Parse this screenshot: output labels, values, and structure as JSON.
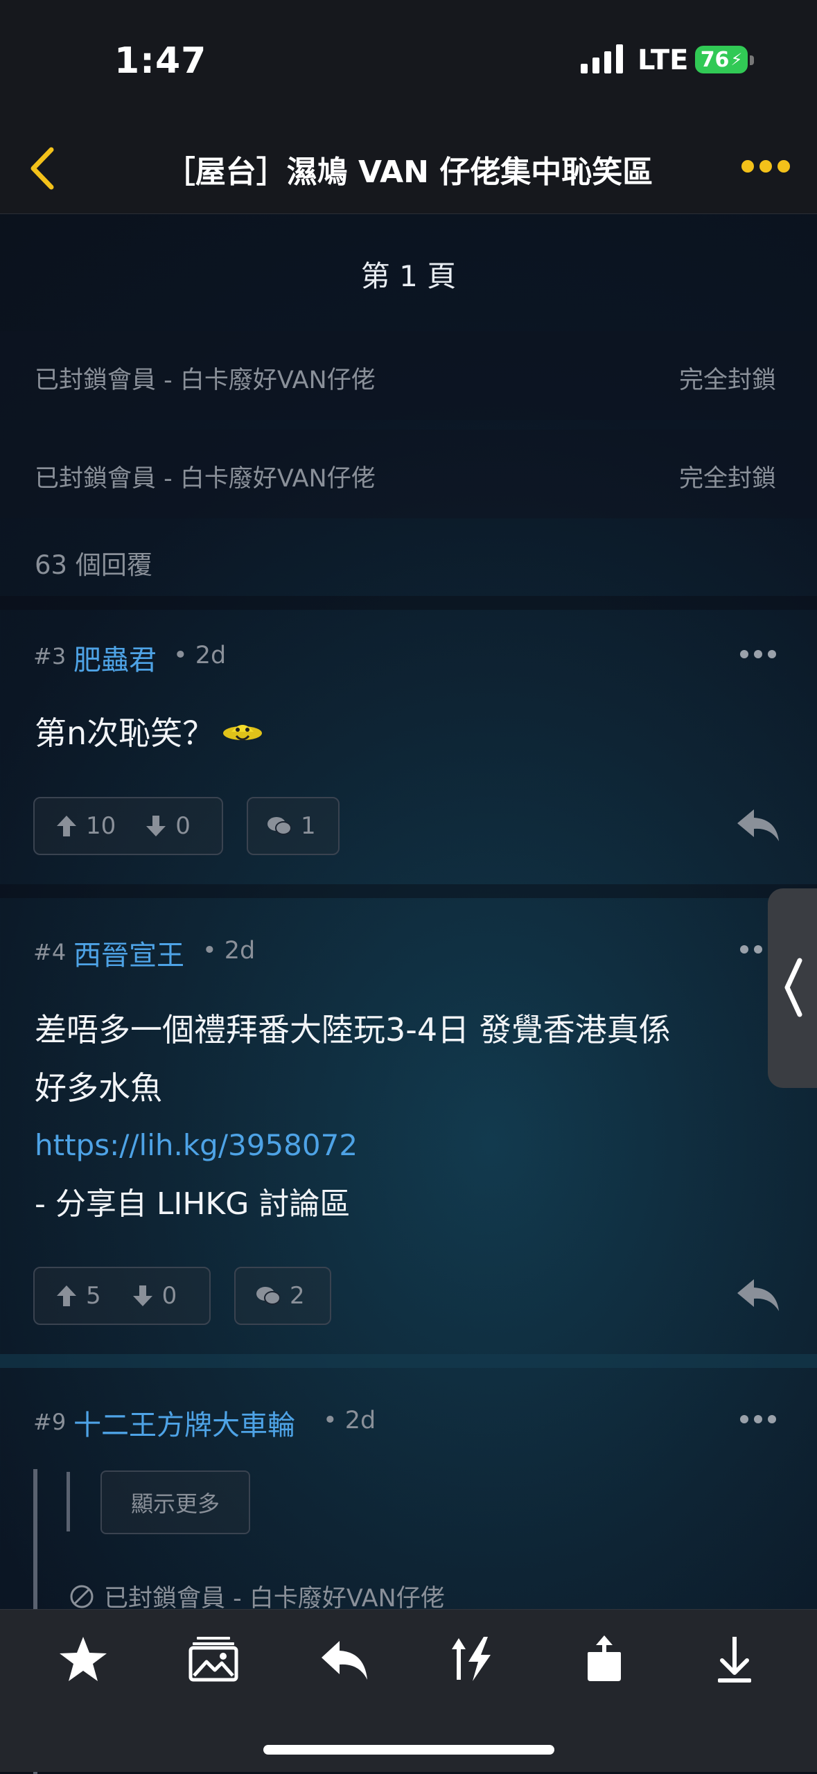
{
  "status_bar": {
    "time": "1:47",
    "network": "LTE",
    "battery": "76"
  },
  "nav": {
    "title": "［屋台］濕鳩 VAN 仔佬集中恥笑區"
  },
  "page_label": "第 1 頁",
  "blocked_rows": [
    {
      "text": "已封鎖會員 - 白卡廢好VAN仔佬",
      "status": "完全封鎖"
    },
    {
      "text": "已封鎖會員 - 白卡廢好VAN仔佬",
      "status": "完全封鎖"
    }
  ],
  "reply_count": "63 個回覆",
  "posts": [
    {
      "num": "#3",
      "author": "肥蟲君",
      "time": "• 2d",
      "body": [
        "第n次恥笑？"
      ],
      "up": "10",
      "down": "0",
      "comments": "1"
    },
    {
      "num": "#4",
      "author": "西晉宣王",
      "time": "• 2d",
      "body": [
        "差唔多一個禮拜番大陸玩3-4日 發覺香港真係",
        "好多水魚"
      ],
      "link": "https://lih.kg/3958072",
      "footer": "- 分享自 LIHKG 討論區",
      "up": "5",
      "down": "0",
      "comments": "2"
    },
    {
      "num": "#9",
      "author": "十二王方牌大車輪",
      "time": "• 2d",
      "show_more": "顯示更多",
      "blocked_quote": "已封鎖會員 - 白卡廢好VAN仔佬"
    }
  ],
  "colors": {
    "accent": "#f3c11a",
    "link": "#4ea3e6",
    "battery": "#31c955"
  }
}
